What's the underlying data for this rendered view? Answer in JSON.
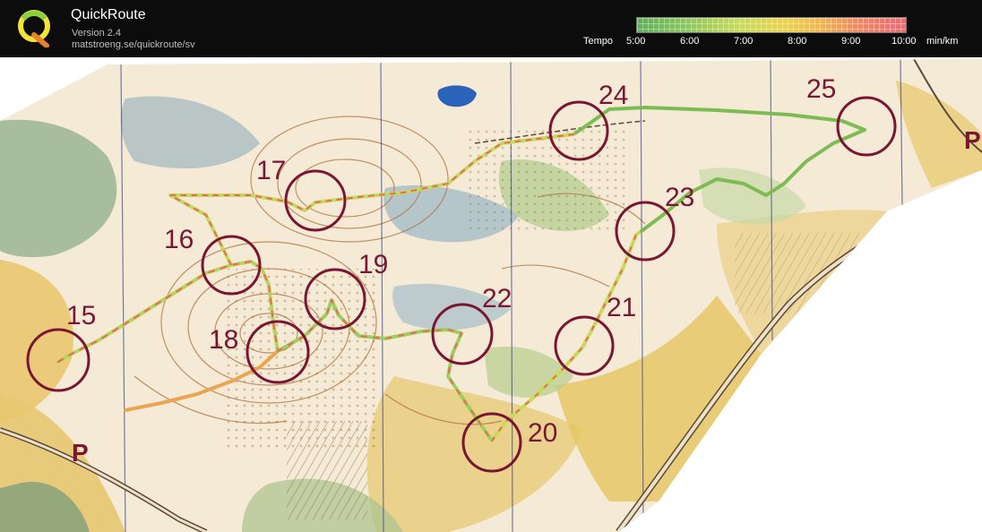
{
  "header": {
    "app_title": "QuickRoute",
    "version": "Version 2.4",
    "url": "matstroeng.se/quickroute/sv"
  },
  "pace_scale": {
    "label": "Tempo",
    "ticks": [
      "5:00",
      "6:00",
      "7:00",
      "8:00",
      "9:00",
      "10:00"
    ],
    "unit": "min/km",
    "colors": [
      "#5fae5a",
      "#8cc65e",
      "#c9da5a",
      "#ead24e",
      "#f0b74f",
      "#ee8a63",
      "#e96b76"
    ]
  },
  "map": {
    "control_color": "#7a1631",
    "controls": [
      "15",
      "16",
      "17",
      "18",
      "19",
      "20",
      "21",
      "22",
      "23",
      "24",
      "25"
    ],
    "parking_symbol": "P"
  }
}
